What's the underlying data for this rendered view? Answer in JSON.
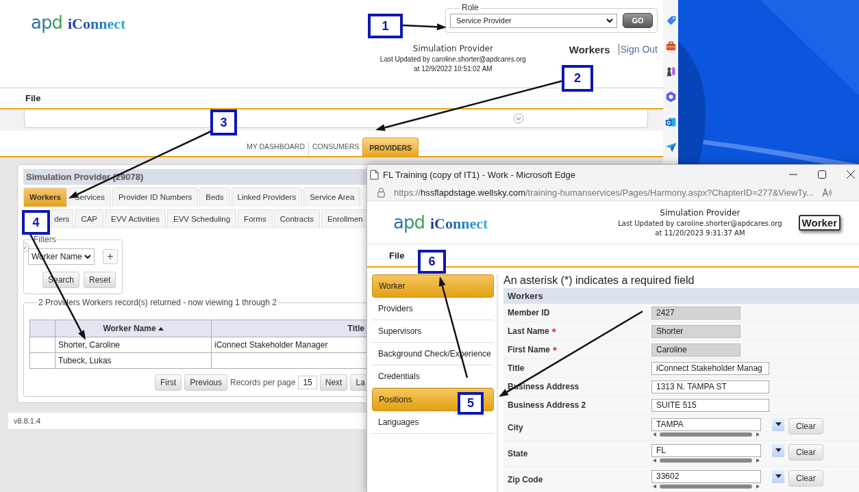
{
  "page": {
    "logo": {
      "mark": "apd",
      "name": "iConnect"
    },
    "role": {
      "legend": "Role",
      "value": "Service Provider",
      "go": "GO"
    },
    "user": {
      "name": "Simulation Provider",
      "updated": "Last Updated by caroline.shorter@apdcares.org",
      "time": "at 12/9/2022 10:51:02 AM"
    },
    "current_page": "Workers",
    "sign_out": "Sign Out",
    "menu": [
      "File"
    ],
    "nav_tabs": [
      {
        "label": "MY DASHBOARD",
        "selected": false
      },
      {
        "label": "CONSUMERS",
        "selected": false
      },
      {
        "label": "PROVIDERS",
        "selected": true
      }
    ],
    "provider": {
      "title": "Simulation Provider (29078)",
      "tab_rows": [
        {
          "tabs": [
            {
              "label": "Workers",
              "selected": true
            },
            {
              "label": "Services",
              "selected": false
            },
            {
              "label": "Provider ID Numbers",
              "selected": false
            },
            {
              "label": "Beds",
              "selected": false
            },
            {
              "label": "Linked Providers",
              "selected": false
            },
            {
              "label": "Service Area",
              "selected": false
            }
          ]
        },
        {
          "tabs": [
            {
              "label": "ders",
              "selected": false
            },
            {
              "label": "CAP",
              "selected": false
            },
            {
              "label": "EVV Activities",
              "selected": false
            },
            {
              "label": "EVV Scheduling",
              "selected": false
            },
            {
              "label": "Forms",
              "selected": false
            },
            {
              "label": "Contracts",
              "selected": false
            },
            {
              "label": "Enrollmen",
              "selected": false
            }
          ]
        }
      ],
      "filters": {
        "legend": "Filters",
        "field": "Worker Name",
        "add": "+",
        "buttons": [
          "Search",
          "Reset"
        ]
      },
      "results": {
        "legend": "2 Providers Workers record(s) returned - now viewing 1 through 2",
        "columns": [
          {
            "label": "Worker Name",
            "sorted": true
          },
          {
            "label": "Title",
            "sorted": false
          }
        ],
        "rows": [
          {
            "worker_name": "Shorter, Caroline",
            "title": "iConnect Stakeholder Manager"
          },
          {
            "worker_name": "Tubeck, Lukas"
          }
        ],
        "pager": {
          "first": "First",
          "previous": "Previous",
          "per_page_label": "Records per page",
          "per_page": "15",
          "next": "Next",
          "last": "La"
        }
      }
    },
    "version": "v8.8.1.4"
  },
  "browser_window": {
    "title": "FL Training (copy of IT1) - Work - Microsoft Edge",
    "url_scheme": "https://",
    "url_host": "hssflapdstage.wellsky.com",
    "url_path": "/training-humanservices/Pages/Harmony.aspx?ChapterID=277&ViewTy...",
    "logo": {
      "mark": "apd",
      "name": "iConnect"
    },
    "user": {
      "name": "Simulation Provider",
      "updated": "Last Updated by caroline.shorter@apdcares.org",
      "time": "at 11/20/2023 9:31:37 AM"
    },
    "current_page": "Worker",
    "menu": [
      "File"
    ],
    "nav": [
      {
        "label": "Worker",
        "selected": true
      },
      {
        "label": "Providers",
        "selected": false
      },
      {
        "label": "Supervisors",
        "selected": false
      },
      {
        "label": "Background Check/Experience",
        "selected": false
      },
      {
        "label": "Credentials",
        "selected": false
      },
      {
        "label": "Positions",
        "selected": true
      },
      {
        "label": "Languages",
        "selected": false
      }
    ],
    "note": "An asterisk (*) indicates a required field",
    "section": "Workers",
    "fields": [
      {
        "kind": "readonly",
        "label": "Member ID",
        "value": "2427"
      },
      {
        "kind": "readonly",
        "label": "Last Name",
        "required_mark": "*",
        "value": "Shorter"
      },
      {
        "kind": "readonly",
        "label": "First Name",
        "required_mark": "*",
        "value": "Caroline"
      },
      {
        "kind": "text",
        "label": "Title",
        "value": "iConnect Stakeholder Manag"
      },
      {
        "kind": "text",
        "label": "Business Address",
        "value": "1313 N. TAMPA ST"
      },
      {
        "kind": "text",
        "label": "Business Address 2",
        "value": "SUITE 515"
      },
      {
        "kind": "lookup",
        "label": "City",
        "value": "TAMPA",
        "clear": "Clear"
      },
      {
        "kind": "lookup",
        "label": "State",
        "value": "FL",
        "clear": "Clear"
      },
      {
        "kind": "lookup",
        "label": "Zip Code",
        "value": "33602",
        "clear": "Clear"
      }
    ]
  },
  "annotations": [
    {
      "number": "1"
    },
    {
      "number": "2"
    },
    {
      "number": "3"
    },
    {
      "number": "4"
    },
    {
      "number": "5"
    },
    {
      "number": "6"
    }
  ]
}
